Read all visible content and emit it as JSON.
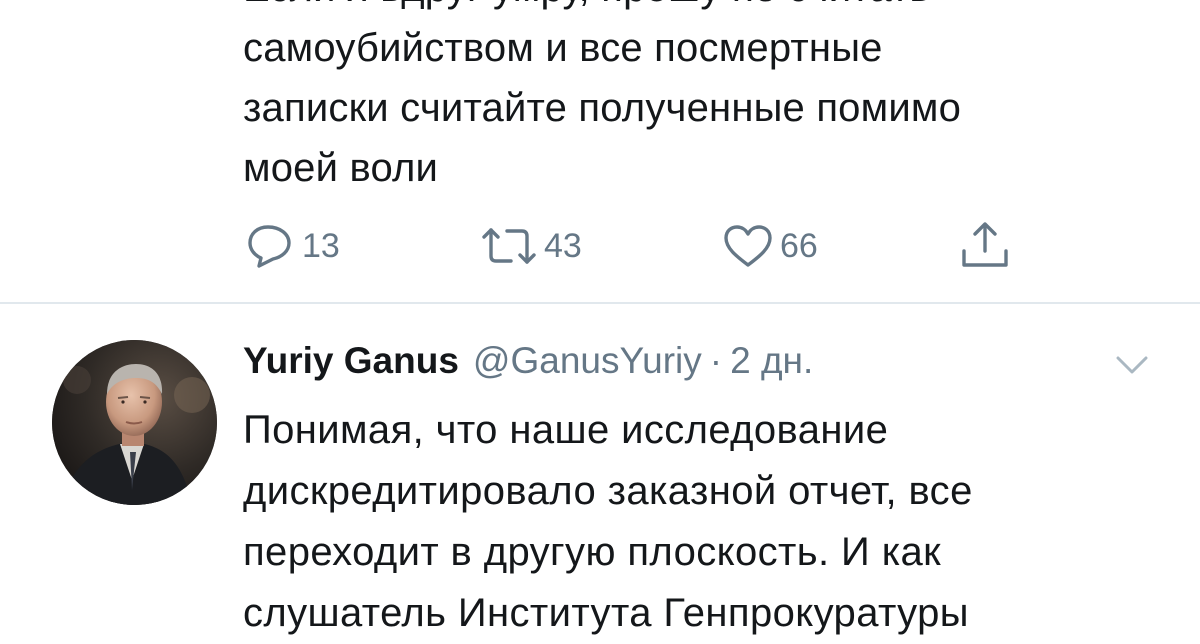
{
  "tweet_1": {
    "text_lines": [
      "Если я вдруг умру, прошу не считать",
      "самоубийством и все посмертные",
      "записки считайте полученные помимо",
      "моей воли"
    ],
    "replies": "13",
    "retweets": "43",
    "likes": "66",
    "icons": {
      "reply": "reply-icon",
      "retweet": "retweet-icon",
      "like": "heart-icon",
      "share": "share-icon"
    }
  },
  "tweet_2": {
    "author_name": "Yuriy Ganus",
    "author_handle": "@GanusYuriy",
    "separator": "·",
    "time": "2 дн.",
    "text_lines": [
      "Понимая, что наше исследование",
      "дискредитировало заказной отчет, все",
      "переходит в другую плоскость. И как",
      "слушатель Института Генпрокуратуры"
    ],
    "icons": {
      "menu": "chevron-down-icon",
      "avatar": "avatar"
    }
  },
  "colors": {
    "text": "#14171a",
    "secondary": "#657786",
    "divider": "#e1e8ed"
  }
}
